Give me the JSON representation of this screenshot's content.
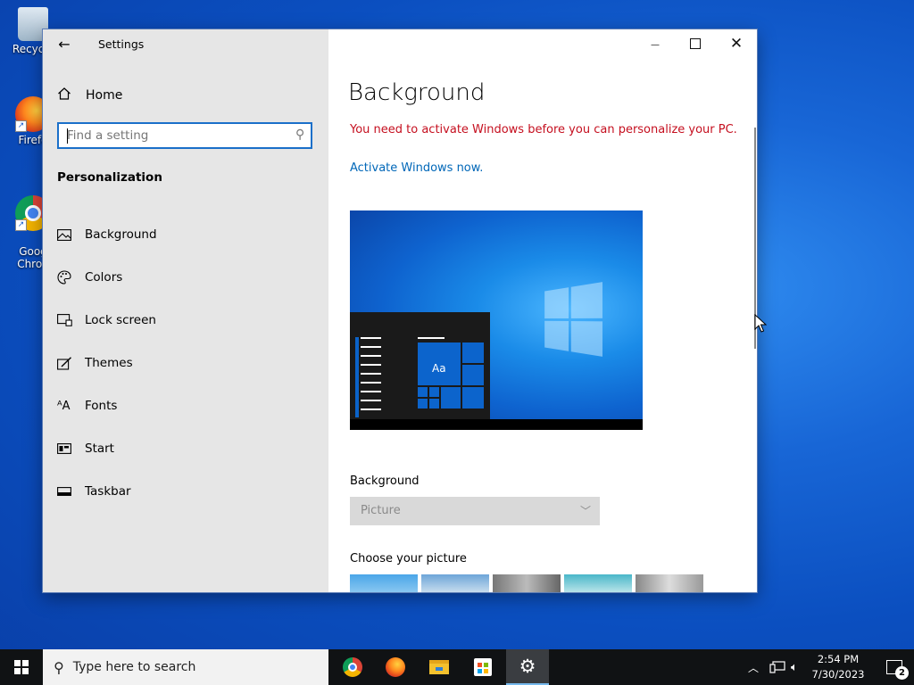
{
  "desktop": {
    "icons": [
      {
        "label": "Recycle",
        "icon": "recycle-bin-icon"
      },
      {
        "label": "Firefo",
        "icon": "firefox-icon"
      },
      {
        "label": "Goog\nChron",
        "icon": "chrome-icon"
      }
    ]
  },
  "window": {
    "title": "Settings",
    "controls": {
      "minimize": "—",
      "close": "✕"
    }
  },
  "sidebar": {
    "home_label": "Home",
    "search_placeholder": "Find a setting",
    "section_title": "Personalization",
    "items": [
      {
        "label": "Background",
        "icon": "picture-icon"
      },
      {
        "label": "Colors",
        "icon": "palette-icon"
      },
      {
        "label": "Lock screen",
        "icon": "lock-screen-icon"
      },
      {
        "label": "Themes",
        "icon": "themes-icon"
      },
      {
        "label": "Fonts",
        "icon": "fonts-icon"
      },
      {
        "label": "Start",
        "icon": "start-icon"
      },
      {
        "label": "Taskbar",
        "icon": "taskbar-icon"
      }
    ]
  },
  "content": {
    "title": "Background",
    "warning": "You need to activate Windows before you can personalize your PC.",
    "activate_link": "Activate Windows now.",
    "preview_tile_text": "Aa",
    "background_label": "Background",
    "background_value": "Picture",
    "choose_picture_label": "Choose your picture"
  },
  "taskbar": {
    "search_placeholder": "Type here to search",
    "apps": [
      "chrome-icon",
      "firefox-icon",
      "file-explorer-icon",
      "store-icon",
      "settings-gear-icon"
    ],
    "time": "2:54 PM",
    "date": "7/30/2023",
    "notification_count": "2"
  },
  "colors": {
    "accent": "#0067b8",
    "warning": "#c50f1f",
    "sidebar_bg": "#e6e6e6"
  }
}
